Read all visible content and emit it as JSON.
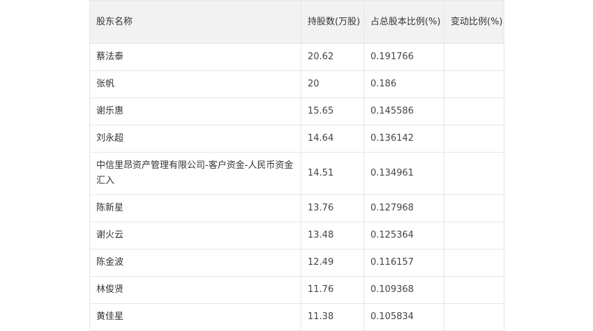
{
  "table": {
    "headers": [
      "股东名称",
      "持股数(万股)",
      "占总股本比例(%)",
      "变动比例(%)"
    ],
    "rows": [
      {
        "name": "蔡法泰",
        "shares": "20.62",
        "ratio": "0.191766",
        "change": ""
      },
      {
        "name": "张帆",
        "shares": "20",
        "ratio": "0.186",
        "change": ""
      },
      {
        "name": "谢乐惠",
        "shares": "15.65",
        "ratio": "0.145586",
        "change": ""
      },
      {
        "name": "刘永超",
        "shares": "14.64",
        "ratio": "0.136142",
        "change": ""
      },
      {
        "name": "中信里昂资产管理有限公司-客户资金-人民币资金汇入",
        "shares": "14.51",
        "ratio": "0.134961",
        "change": ""
      },
      {
        "name": "陈新星",
        "shares": "13.76",
        "ratio": "0.127968",
        "change": ""
      },
      {
        "name": "谢火云",
        "shares": "13.48",
        "ratio": "0.125364",
        "change": ""
      },
      {
        "name": "陈金波",
        "shares": "12.49",
        "ratio": "0.116157",
        "change": ""
      },
      {
        "name": "林俊贤",
        "shares": "11.76",
        "ratio": "0.109368",
        "change": ""
      },
      {
        "name": "黄佳星",
        "shares": "11.38",
        "ratio": "0.105834",
        "change": ""
      }
    ]
  }
}
